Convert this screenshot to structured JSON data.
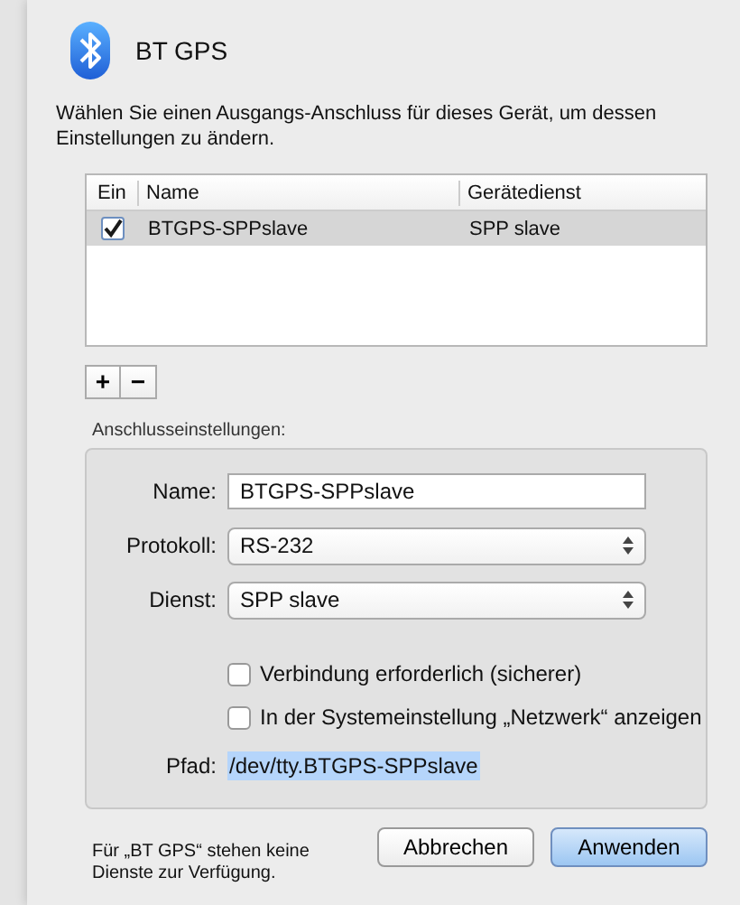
{
  "dialog": {
    "title": "BT GPS",
    "instruction": "Wählen Sie einen Ausgangs-Anschluss für dieses Gerät, um dessen Einstellungen zu ändern.",
    "table": {
      "columns": [
        "Ein",
        "Name",
        "Gerätedienst"
      ],
      "rows": [
        {
          "enabled": true,
          "name": "BTGPS-SPPslave",
          "service": "SPP slave",
          "selected": true
        }
      ]
    },
    "list_buttons": [
      "+",
      "−"
    ],
    "settings": {
      "heading": "Anschlusseinstellungen:",
      "fields": [
        {
          "kind": "text",
          "label": "Name:",
          "value": "BTGPS-SPPslave"
        },
        {
          "kind": "popup",
          "label": "Protokoll:",
          "value": "RS-232"
        },
        {
          "kind": "popup",
          "label": "Dienst:",
          "value": "SPP slave"
        }
      ],
      "options": [
        {
          "label": "Verbindung erforderlich (sicherer)",
          "checked": false
        },
        {
          "label": "In der Systemeinstellung „Netzwerk“ anzeigen",
          "checked": false
        }
      ],
      "path": {
        "label": "Pfad:",
        "value": "/dev/tty.BTGPS-SPPslave"
      }
    },
    "note": "Für „BT GPS“ stehen keine Dienste zur Verfügung.",
    "buttons": [
      {
        "label": "Abbrechen",
        "default": false
      },
      {
        "label": "Anwenden",
        "default": true
      }
    ]
  }
}
